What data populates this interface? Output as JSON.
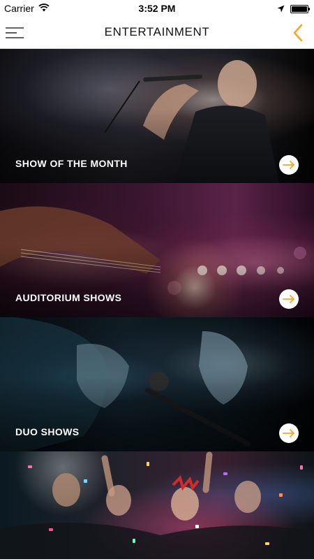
{
  "status_bar": {
    "carrier": "Carrier",
    "time": "3:52 PM",
    "battery_level": 1.0
  },
  "nav": {
    "title": "ENTERTAINMENT",
    "menu_icon": "hamburger-menu-icon",
    "back_icon": "chevron-left-icon",
    "accent_color": "#F5A623"
  },
  "cards": [
    {
      "label": "SHOW OF THE MONTH",
      "image": "singer-with-microphone",
      "icon": "arrow-right-icon"
    },
    {
      "label": "AUDITORIUM SHOWS",
      "image": "guitarist-stage-lights",
      "icon": "arrow-right-icon"
    },
    {
      "label": "DUO SHOWS",
      "image": "two-singers-duet",
      "icon": "arrow-right-icon"
    },
    {
      "label": "",
      "image": "party-crowd-confetti"
    }
  ]
}
